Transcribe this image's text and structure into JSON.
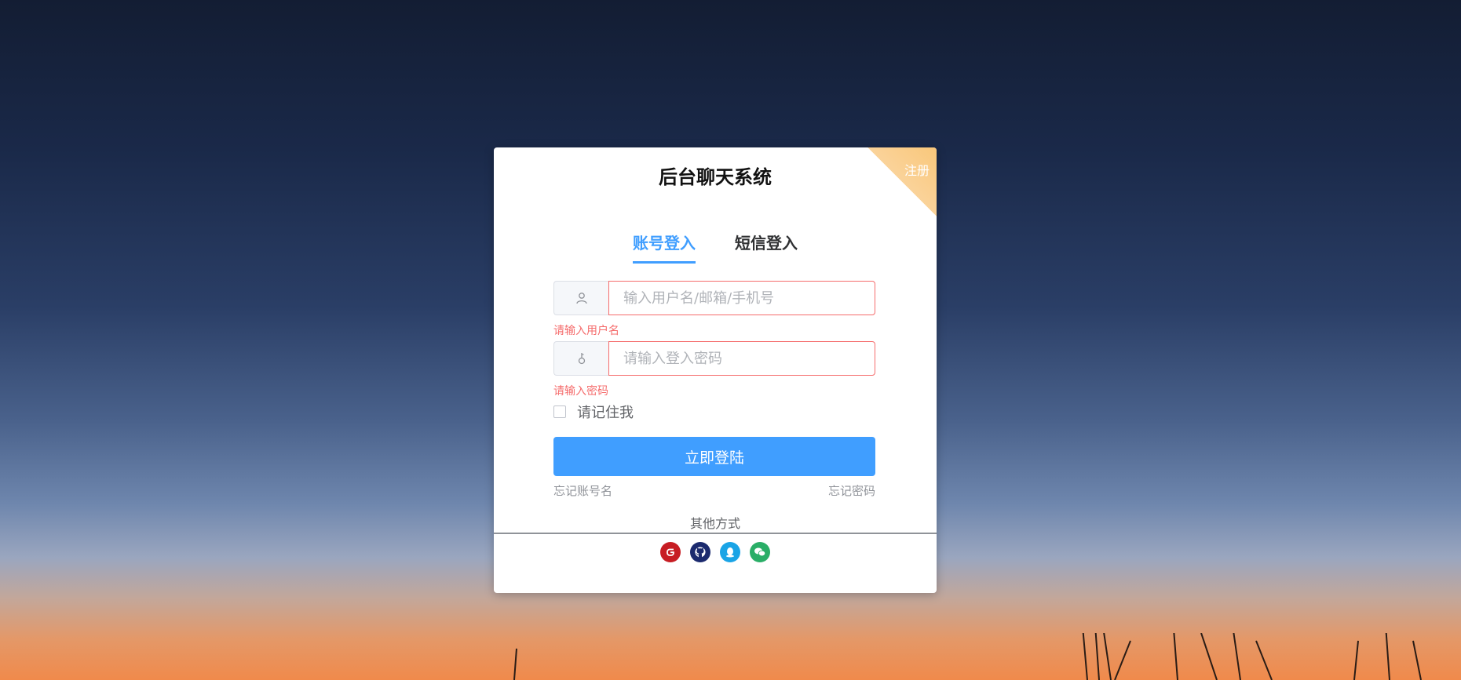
{
  "app": {
    "title": "后台聊天系统",
    "register_label": "注册"
  },
  "tabs": [
    {
      "label": "账号登入",
      "active": true
    },
    {
      "label": "短信登入",
      "active": false
    }
  ],
  "form": {
    "username": {
      "placeholder": "输入用户名/邮箱/手机号",
      "value": "",
      "error": "请输入用户名",
      "icon": "user-icon"
    },
    "password": {
      "placeholder": "请输入登入密码",
      "value": "",
      "error": "请输入密码",
      "icon": "key-icon"
    },
    "remember_label": "请记住我",
    "remember_checked": false,
    "submit_label": "立即登陆",
    "forgot_account": "忘记账号名",
    "forgot_password": "忘记密码"
  },
  "other_methods": {
    "label": "其他方式",
    "providers": [
      {
        "icon": "gitee-icon",
        "color": "#c71d23"
      },
      {
        "icon": "github-icon",
        "color": "#1b2a6e"
      },
      {
        "icon": "qq-icon",
        "color": "#1aa4e6"
      },
      {
        "icon": "wechat-icon",
        "color": "#2aae67"
      }
    ]
  },
  "colors": {
    "primary": "#409eff",
    "error": "#f56c6c",
    "ribbon": "#f9c77a"
  }
}
